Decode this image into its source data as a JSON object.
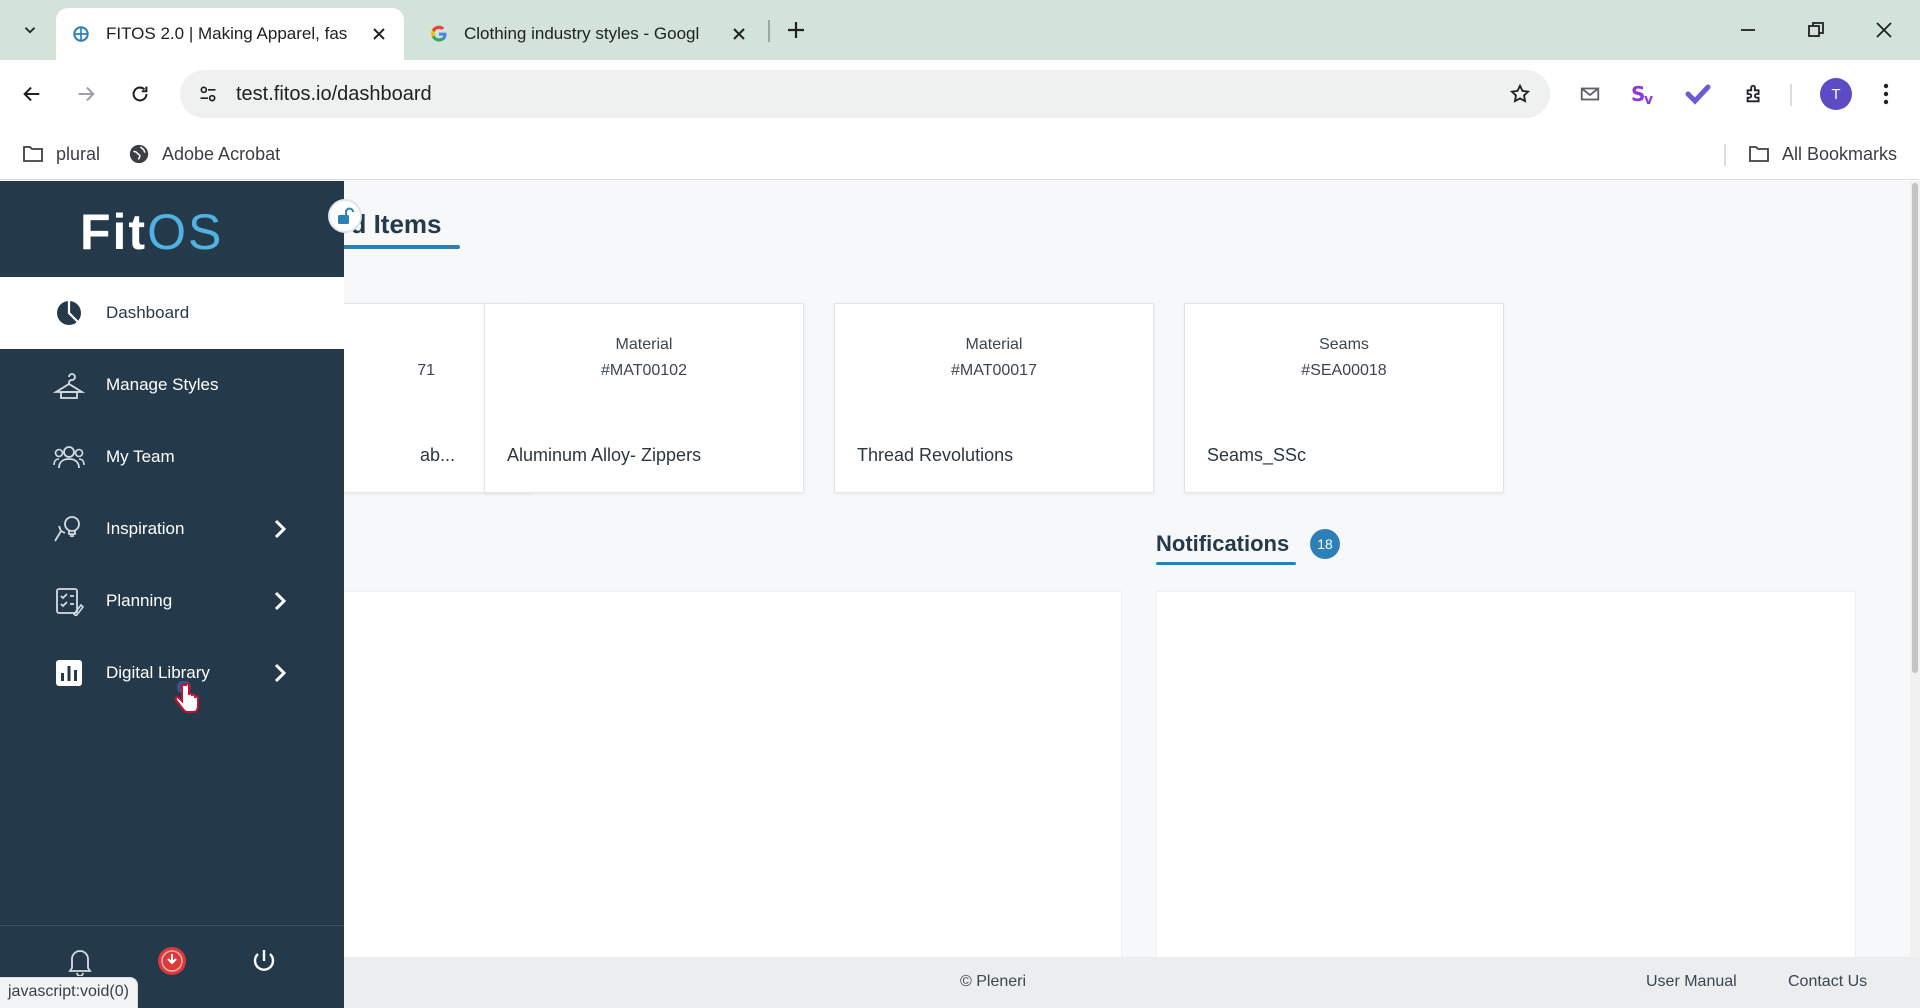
{
  "browser": {
    "tabs": [
      {
        "title": "FITOS 2.0 | Making Apparel, fas",
        "active": true
      },
      {
        "title": "Clothing industry styles - Googl",
        "active": false
      }
    ],
    "url": "test.fitos.io/dashboard",
    "profile_initial": "T",
    "bookmarks": [
      {
        "label": "plural"
      },
      {
        "label": "Adobe Acrobat"
      }
    ],
    "all_bookmarks_label": "All Bookmarks",
    "status_text": "javascript:void(0)"
  },
  "sidebar": {
    "logo_fit": "Fit",
    "logo_os": "OS",
    "items": [
      {
        "label": "Dashboard",
        "icon": "pie-chart-icon",
        "active": true,
        "has_children": false
      },
      {
        "label": "Manage Styles",
        "icon": "hanger-icon",
        "active": false,
        "has_children": false
      },
      {
        "label": "My Team",
        "icon": "team-icon",
        "active": false,
        "has_children": false
      },
      {
        "label": "Inspiration",
        "icon": "idea-icon",
        "active": false,
        "has_children": true
      },
      {
        "label": "Planning",
        "icon": "checklist-icon",
        "active": false,
        "has_children": true
      },
      {
        "label": "Digital Library",
        "icon": "bar-chart-icon",
        "active": false,
        "has_children": true
      }
    ]
  },
  "main": {
    "section_title": "ed Items",
    "cards": [
      {
        "type": "",
        "code": "71",
        "name": "ab..."
      },
      {
        "type": "Material",
        "code": "#MAT00102",
        "name": "Aluminum Alloy- Zippers"
      },
      {
        "type": "Material",
        "code": "#MAT00017",
        "name": "Thread Revolutions"
      },
      {
        "type": "Seams",
        "code": "#SEA00018",
        "name": "Seams_SSc"
      }
    ],
    "notifications_title": "Notifications",
    "notifications_count": "18"
  },
  "footer": {
    "copyright": "© Pleneri",
    "user_manual": "User Manual",
    "contact_us": "Contact Us"
  },
  "colors": {
    "sidebar_bg": "#243a4b",
    "accent": "#2d7fb8",
    "logo_os": "#4fb2e0"
  }
}
